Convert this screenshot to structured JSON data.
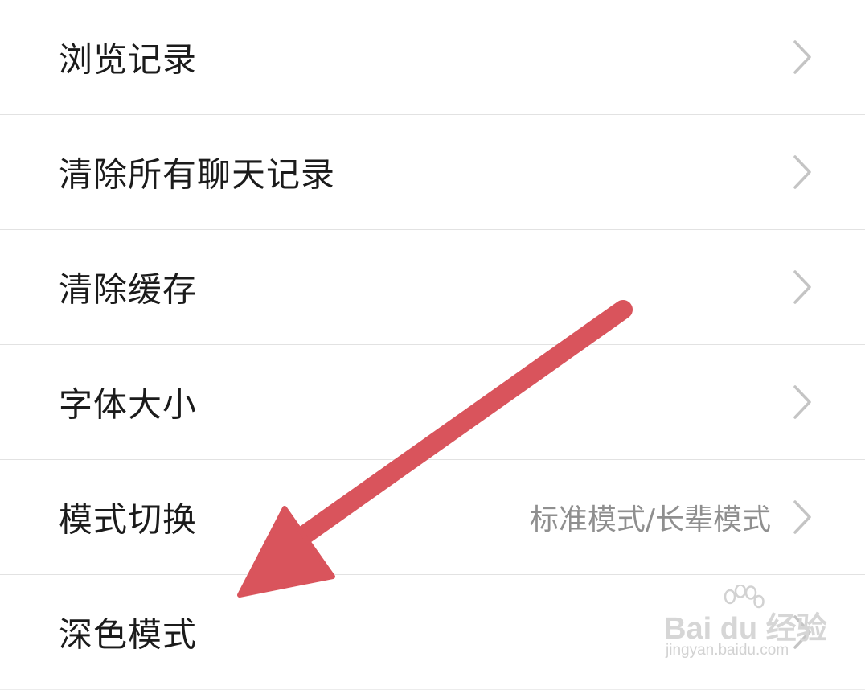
{
  "settings": {
    "items": [
      {
        "label": "浏览记录",
        "value": ""
      },
      {
        "label": "清除所有聊天记录",
        "value": ""
      },
      {
        "label": "清除缓存",
        "value": ""
      },
      {
        "label": "字体大小",
        "value": ""
      },
      {
        "label": "模式切换",
        "value": "标准模式/长辈模式"
      },
      {
        "label": "深色模式",
        "value": ""
      }
    ]
  },
  "annotation": {
    "arrow_color": "#d9545c",
    "arrow_icon": "arrow-pointer-icon"
  },
  "watermark": {
    "logo_text": "Bai du 经验",
    "url": "jingyan.baidu.com",
    "icon": "baidu-paw-icon"
  },
  "colors": {
    "background": "#ffffff",
    "label_text": "#1b1b1b",
    "value_text": "#8f8f8f",
    "chevron": "#c4c4c4",
    "divider": "#e2e2e2"
  }
}
